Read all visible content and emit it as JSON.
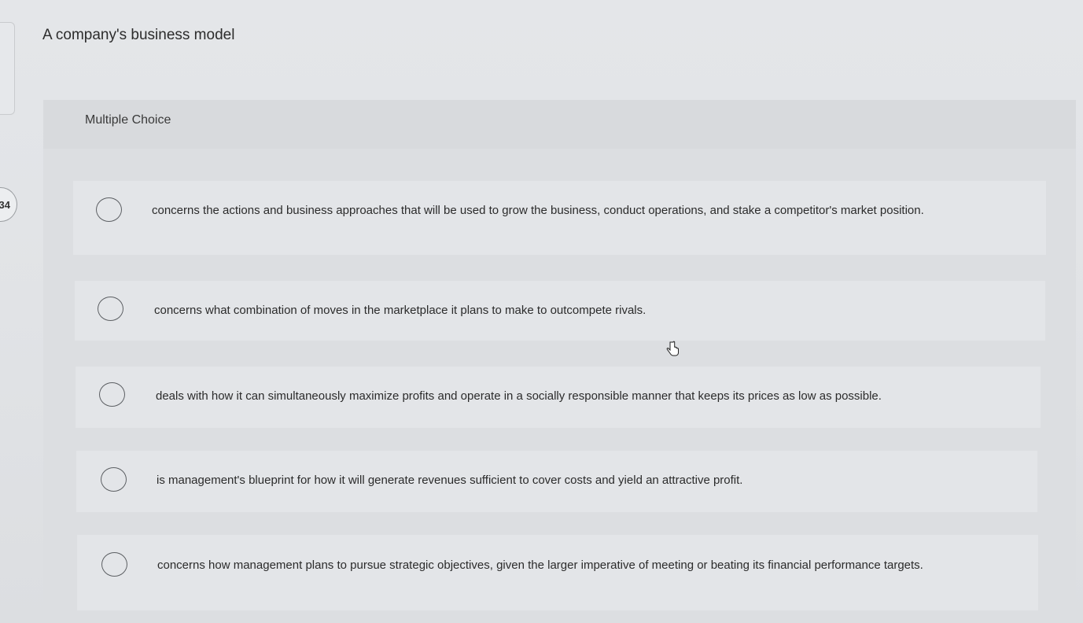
{
  "question": {
    "number": "34",
    "prompt": "A company's business model",
    "type_label": "Multiple Choice",
    "options": [
      {
        "text": "concerns the actions and business approaches that will be used to grow the business, conduct operations, and stake a competitor's market position.",
        "selected": false
      },
      {
        "text": "concerns what combination of moves in the marketplace it plans to make to outcompete rivals.",
        "selected": false
      },
      {
        "text": "deals with how it can simultaneously maximize profits and operate in a socially responsible manner that keeps its prices as low as possible.",
        "selected": false
      },
      {
        "text": "is management's blueprint for how it will generate revenues sufficient to cover costs and yield an attractive profit.",
        "selected": false
      },
      {
        "text": "concerns how management plans to pursue strategic objectives, given the larger imperative of meeting or beating its financial performance targets.",
        "selected": false
      }
    ]
  },
  "cursor": {
    "icon": "hand-pointer-icon"
  }
}
